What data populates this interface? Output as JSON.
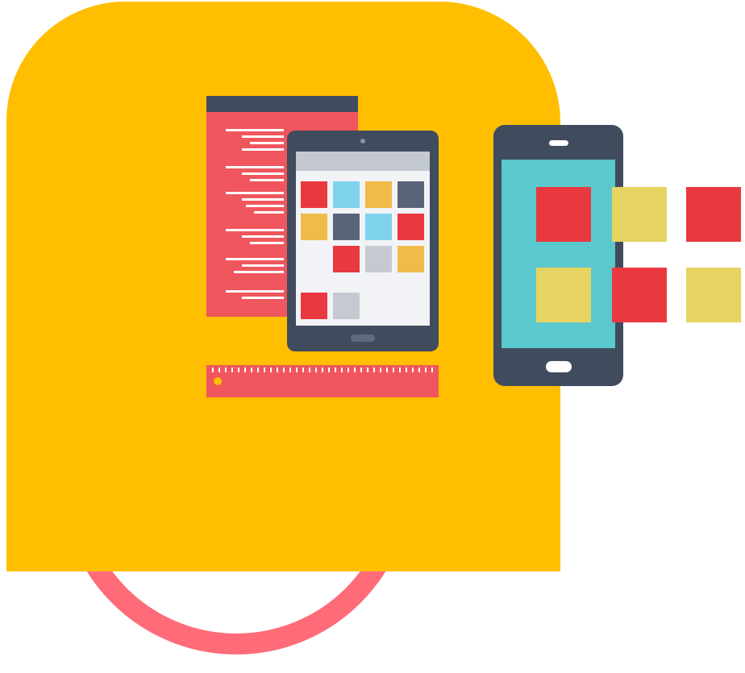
{
  "illustration": {
    "subject": "responsive-design",
    "icons": [
      "code-document-icon",
      "tablet-icon",
      "ruler-icon",
      "smartphone-icon",
      "app-tiles-icon"
    ]
  },
  "colors": {
    "background": "#ffffff",
    "panel": "#FFBE00",
    "ring": "#FF6B78",
    "device_frame": "#404B5E",
    "tablet_screen": "#F2F3F7",
    "tablet_screen_header": "#C4C8D0",
    "phone_screen": "#5BC8CD",
    "document": "#F0565D",
    "document_header": "#404B5E",
    "ruler": "#F0565D",
    "tile_red": "#E9393F",
    "tile_yellow": "#E7D362",
    "tile_blue": "#7FD3EC",
    "tile_orange": "#F0BB46",
    "tile_slate": "#5A6479",
    "tile_gray": "#C5C9D1"
  }
}
